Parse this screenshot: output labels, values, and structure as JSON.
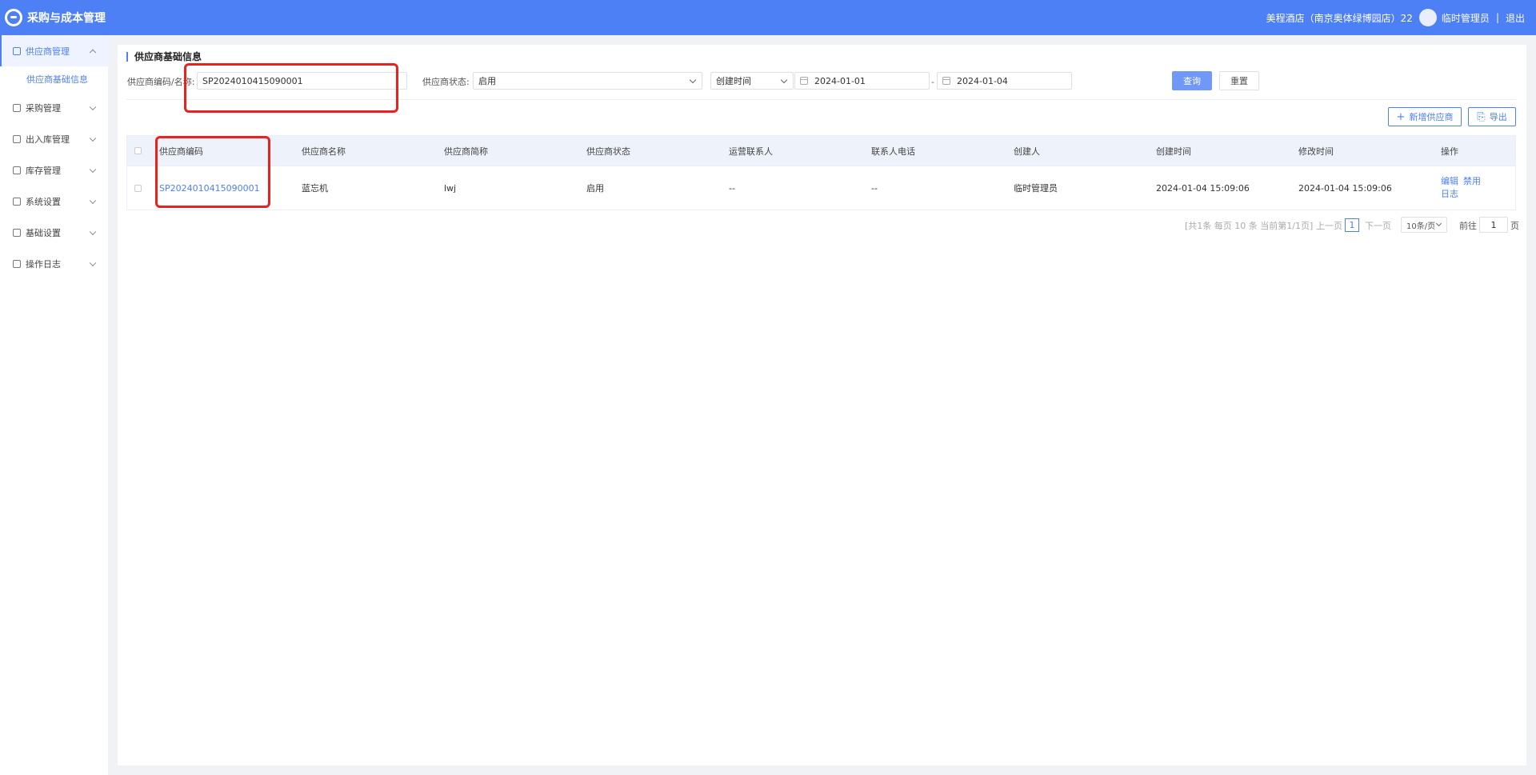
{
  "app": {
    "title": "采购与成本管理"
  },
  "header": {
    "store": "美程酒店（南京奥体绿博园店）22",
    "user": "临时管理员",
    "separator": "|",
    "logout": "退出"
  },
  "sidebar": {
    "items": [
      {
        "label": "供应商管理",
        "expanded": true,
        "active": true,
        "icon": "supplier-icon"
      },
      {
        "label": "采购管理",
        "icon": "purchase-icon"
      },
      {
        "label": "出入库管理",
        "icon": "stock-io-icon"
      },
      {
        "label": "库存管理",
        "icon": "inventory-icon"
      },
      {
        "label": "系统设置",
        "icon": "system-icon"
      },
      {
        "label": "基础设置",
        "icon": "gear-icon"
      },
      {
        "label": "操作日志",
        "icon": "log-icon"
      }
    ],
    "sub_items": [
      {
        "label": "供应商基础信息",
        "active": true
      }
    ]
  },
  "page": {
    "title": "供应商基础信息"
  },
  "filters": {
    "code_label": "供应商编码/名称:",
    "code_value": "SP2024010415090001",
    "status_label": "供应商状态:",
    "status_value": "启用",
    "time_type": "创建时间",
    "date_start": "2024-01-01",
    "date_sep": "-",
    "date_end": "2024-01-04",
    "query_btn": "查询",
    "reset_btn": "重置"
  },
  "actions": {
    "add_btn": "新增供应商",
    "add_icon": "+",
    "export_btn": "导出"
  },
  "table": {
    "columns": [
      "供应商编码",
      "供应商名称",
      "供应商简称",
      "供应商状态",
      "运营联系人",
      "联系人电话",
      "创建人",
      "创建时间",
      "修改时间",
      "操作"
    ],
    "rows": [
      {
        "code": "SP2024010415090001",
        "name": "蓝忘机",
        "short": "lwj",
        "status": "启用",
        "contact": "--",
        "phone": "--",
        "creator": "临时管理员",
        "created": "2024-01-04 15:09:06",
        "modified": "2024-01-04 15:09:06",
        "ops": [
          "编辑",
          "禁用",
          "日志"
        ]
      }
    ]
  },
  "pagination": {
    "summary": "[共1条 每页 10 条 当前第1/1页]",
    "prev": "上一页",
    "current": "1",
    "next": "下一页",
    "page_size": "10条/页",
    "goto_label": "前往",
    "goto_value": "1",
    "goto_suffix": "页"
  },
  "colors": {
    "primary": "#4d7ff5",
    "annotation": "#e8231f"
  }
}
